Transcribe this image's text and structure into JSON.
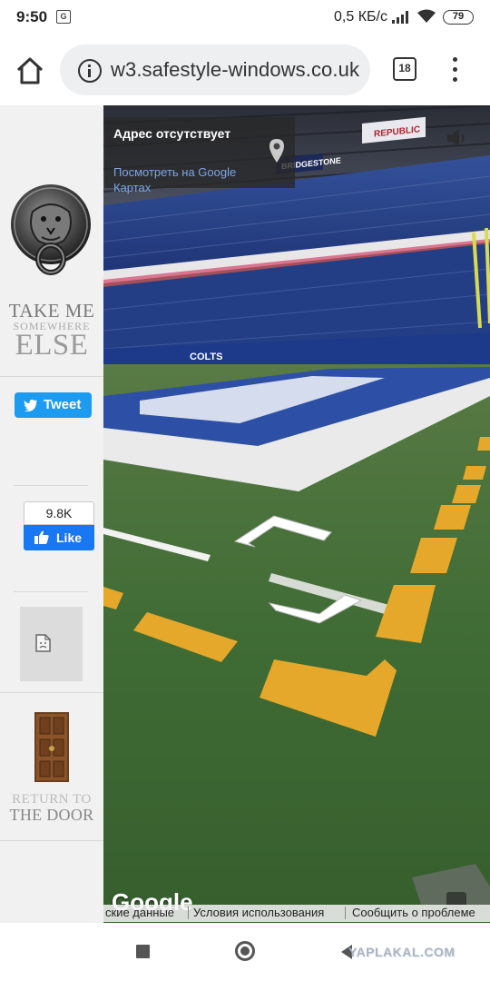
{
  "status_bar": {
    "time": "9:50",
    "net_speed": "0,5 КБ/с",
    "battery": "79",
    "icons": [
      "translate-icon",
      "signal-icon",
      "wifi-icon",
      "battery-icon"
    ]
  },
  "browser": {
    "url": "w3.safestyle-windows.co.uk",
    "tab_count": "18",
    "icons": [
      "home-icon",
      "info-icon",
      "tab-switcher-icon",
      "more-vert-icon"
    ]
  },
  "sidebar": {
    "take_me_line1": "TAKE ME",
    "take_me_line2": "SOMEWHERE",
    "take_me_line3": "ELSE",
    "tweet_label": "Tweet",
    "like_count": "9.8K",
    "like_label": "Like",
    "return_line1": "RETURN TO",
    "return_line2": "THE DOOR"
  },
  "street_view": {
    "address_title": "Адрес отсутствует",
    "maps_link": "Посмотреть на Google Картах",
    "google_logo": "Google",
    "map_data_link": "ские данные",
    "terms_link": "Условия использования",
    "report_link": "Сообщить о проблеме",
    "stadium_sign_republic": "REPUBLIC",
    "stadium_sign_colts": "COLTS",
    "stadium_sign_bridgestone": "BRIDGESTONE"
  },
  "watermark": "YAPLAKAL.COM",
  "colors": {
    "tweet_blue": "#1d9bf0",
    "like_blue": "#1877f2",
    "field_green": "#3f6e35",
    "endzone_blue": "#2d4fa6",
    "yard_yellow": "#e5a82a",
    "link_blue": "#7aa6e8"
  }
}
